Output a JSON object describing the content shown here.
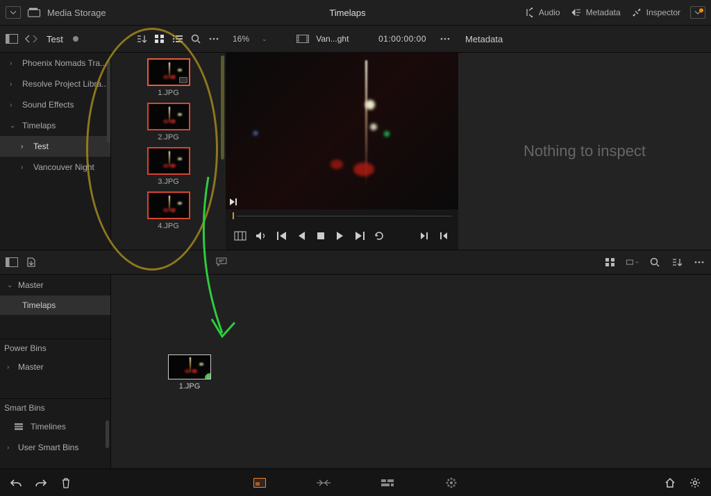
{
  "topbar": {
    "media_storage": "Media Storage",
    "project_title": "Timelaps",
    "audio": "Audio",
    "metadata": "Metadata",
    "inspector": "Inspector"
  },
  "toolrow": {
    "folder": "Test",
    "zoom": "16%",
    "clip_name": "Van...ght",
    "timecode": "01:00:00:00",
    "metadata_label": "Metadata"
  },
  "tree": {
    "items": [
      {
        "label": "Phoenix Nomads Tra...",
        "expand": "›"
      },
      {
        "label": "Resolve Project Libra...",
        "expand": "›"
      },
      {
        "label": "Sound Effects",
        "expand": "›"
      },
      {
        "label": "Timelaps",
        "expand": "⌄"
      },
      {
        "label": "Test",
        "expand": "›"
      },
      {
        "label": "Vancouver Night",
        "expand": "›"
      }
    ]
  },
  "thumbs": [
    {
      "label": "1.JPG"
    },
    {
      "label": "2.JPG"
    },
    {
      "label": "3.JPG"
    },
    {
      "label": "4.JPG"
    }
  ],
  "meta_panel": {
    "nothing": "Nothing to inspect"
  },
  "pool": {
    "master": "Master",
    "timelaps": "Timelaps",
    "power_bins": "Power Bins",
    "pb_master": "Master",
    "smart_bins": "Smart Bins",
    "timelines": "Timelines",
    "user_smart": "User Smart Bins",
    "thumb_label": "1.JPG"
  }
}
